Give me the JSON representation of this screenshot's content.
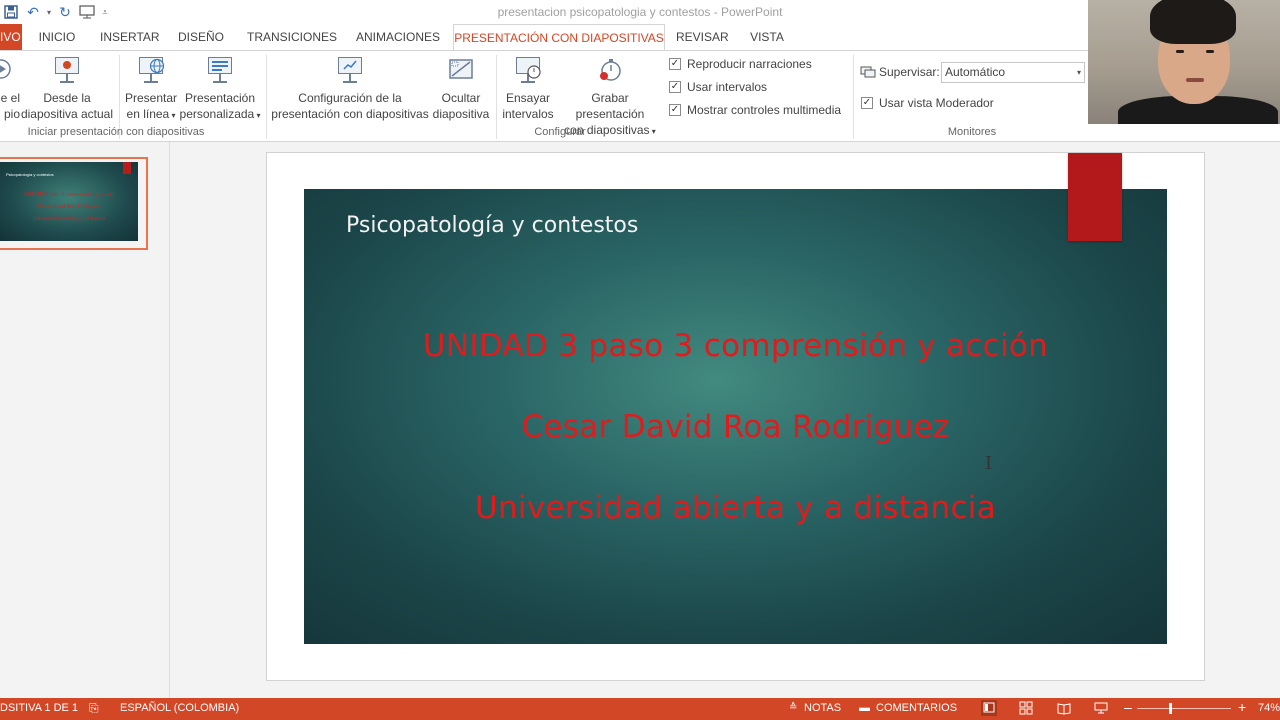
{
  "window": {
    "title": "presentacion psicopatologia y contestos - PowerPoint"
  },
  "tabs": [
    {
      "label": "IVO"
    },
    {
      "label": "INICIO"
    },
    {
      "label": "INSERTAR"
    },
    {
      "label": "DISEÑO"
    },
    {
      "label": "TRANSICIONES"
    },
    {
      "label": "ANIMACIONES"
    },
    {
      "label": "PRESENTACIÓN CON DIAPOSITIVAS"
    },
    {
      "label": "REVISAR"
    },
    {
      "label": "VISTA"
    }
  ],
  "ribbon": {
    "start_group": {
      "from_start": {
        "line1": "e el",
        "line2": "pio"
      },
      "from_current": {
        "line1": "Desde la",
        "line2": "diapositiva actual"
      },
      "present_online": {
        "line1": "Presentar",
        "line2": "en línea"
      },
      "custom": {
        "line1": "Presentación",
        "line2": "personalizada"
      },
      "label": "Iniciar presentación con diapositivas"
    },
    "configure_group": {
      "setup": {
        "line1": "Configuración de la",
        "line2": "presentación con diapositivas"
      },
      "hide": {
        "line1": "Ocultar",
        "line2": "diapositiva"
      },
      "rehearse": {
        "line1": "Ensayar",
        "line2": "intervalos"
      },
      "record": {
        "line1": "Grabar presentación",
        "line2": "con diapositivas"
      },
      "checkboxes": [
        {
          "label": "Reproducir narraciones",
          "checked": true
        },
        {
          "label": "Usar intervalos",
          "checked": true
        },
        {
          "label": "Mostrar controles multimedia",
          "checked": true
        }
      ],
      "label": "Configurar"
    },
    "monitors_group": {
      "monitor_label": "Supervisar:",
      "monitor_value": "Automático",
      "presenter_view": {
        "label": "Usar vista Moderador",
        "checked": true
      },
      "label": "Monitores"
    }
  },
  "thumbnail": {
    "title": "Psicopatología y contestos",
    "lines": [
      "UNIDAD 3 paso 3 comprensión y acción",
      "Cesar David Roa Rodriguez",
      "Universidad abierta y a distancia"
    ]
  },
  "slide": {
    "title": "Psicopatología y contestos",
    "lines": [
      "UNIDAD 3 paso 3 comprensión y acción",
      "Cesar David Roa Rodriguez",
      "Universidad abierta y a distancia"
    ],
    "colors": {
      "title": "#f2f2f2",
      "body": "#e11b1b",
      "accent_tab": "#b3191a"
    }
  },
  "statusbar": {
    "slide_info": "DSITIVA 1 DE 1",
    "language": "ESPAÑOL (COLOMBIA)",
    "notes": "NOTAS",
    "comments": "COMENTARIOS",
    "zoom_minus": "–",
    "zoom_plus": "+",
    "zoom": "74%"
  },
  "theme": {
    "accent": "#d24726"
  }
}
